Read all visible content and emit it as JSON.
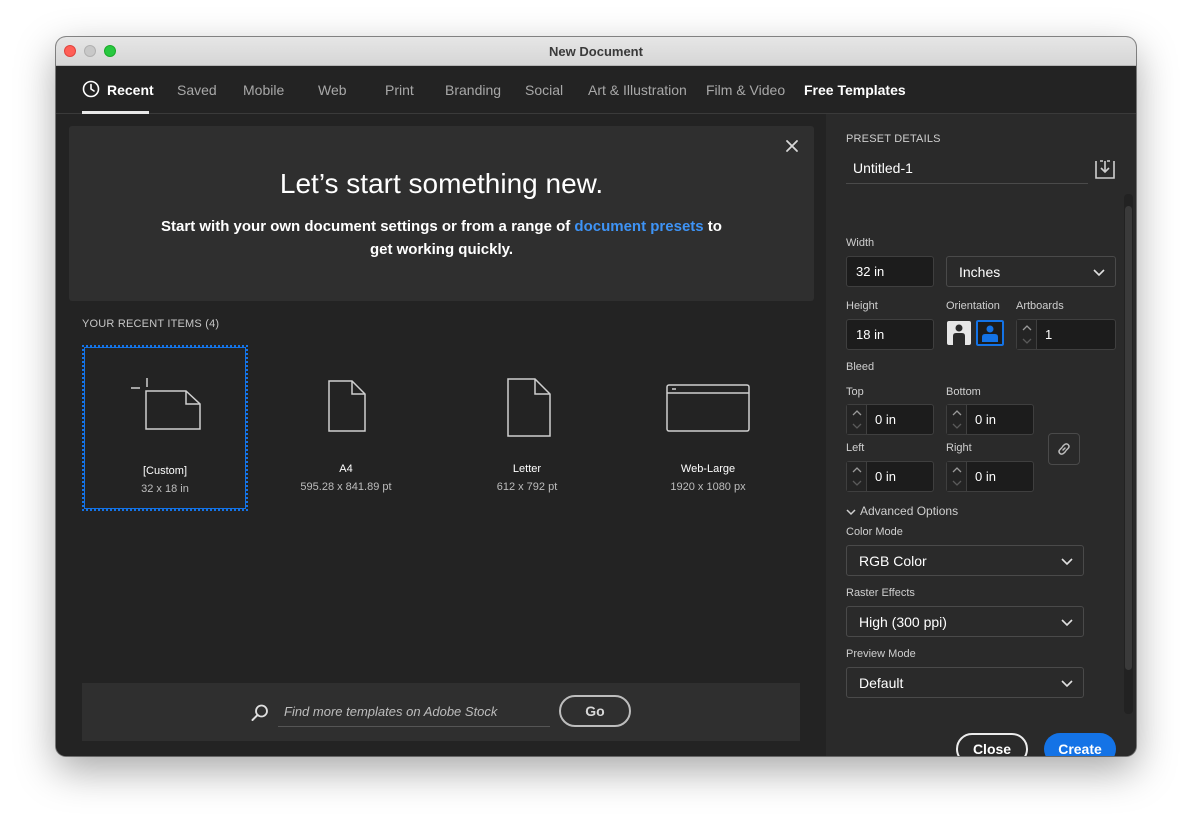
{
  "window": {
    "title": "New Document"
  },
  "tabs": [
    {
      "label": "Recent",
      "active": true
    },
    {
      "label": "Saved"
    },
    {
      "label": "Mobile"
    },
    {
      "label": "Web"
    },
    {
      "label": "Print"
    },
    {
      "label": "Branding"
    },
    {
      "label": "Social"
    },
    {
      "label": "Art & Illustration"
    },
    {
      "label": "Film & Video"
    },
    {
      "label": "Free Templates"
    }
  ],
  "hero": {
    "title": "Let’s start something new.",
    "text_before": "Start with your own document settings or from a range of ",
    "link": "document presets",
    "text_after": " to get working quickly."
  },
  "recent": {
    "heading": "YOUR RECENT ITEMS",
    "count": "(4)",
    "items": [
      {
        "name": "[Custom]",
        "size": "32 x 18 in",
        "icon": "custom-artboard-icon"
      },
      {
        "name": "A4",
        "size": "595.28 x 841.89 pt",
        "icon": "document-icon"
      },
      {
        "name": "Letter",
        "size": "612 x 792 pt",
        "icon": "document-icon"
      },
      {
        "name": "Web-Large",
        "size": "1920 x 1080 px",
        "icon": "browser-window-icon"
      }
    ]
  },
  "stock": {
    "placeholder": "Find more templates on Adobe Stock",
    "go_label": "Go"
  },
  "preset": {
    "heading": "PRESET DETAILS",
    "name": "Untitled-1",
    "width_label": "Width",
    "width": "32 in",
    "units": "Inches",
    "height_label": "Height",
    "height": "18 in",
    "orientation_label": "Orientation",
    "artboards_label": "Artboards",
    "artboards": "1",
    "bleed_label": "Bleed",
    "top_label": "Top",
    "top": "0 in",
    "bottom_label": "Bottom",
    "bottom": "0 in",
    "left_label": "Left",
    "left": "0 in",
    "right_label": "Right",
    "right": "0 in",
    "advanced_label": "Advanced Options",
    "color_mode_label": "Color Mode",
    "color_mode": "RGB Color",
    "raster_label": "Raster Effects",
    "raster": "High (300 ppi)",
    "preview_label": "Preview Mode",
    "preview": "Default"
  },
  "actions": {
    "close_label": "Close",
    "create_label": "Create"
  },
  "colors": {
    "accent": "#1473e6",
    "link": "#3e93f5",
    "panel": "#2a2a2a",
    "background": "#232323"
  }
}
